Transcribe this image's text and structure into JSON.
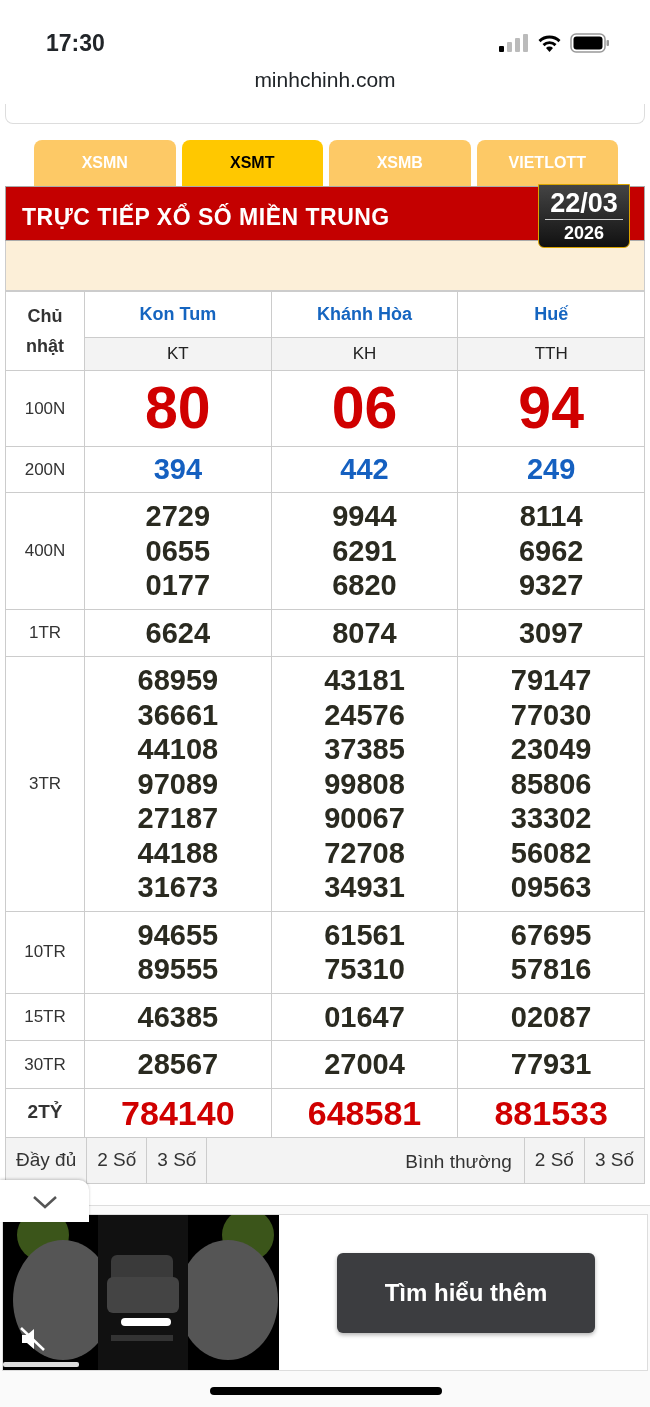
{
  "status_bar": {
    "time": "17:30"
  },
  "browser": {
    "url": "minhchinh.com"
  },
  "tabs": [
    {
      "label": "XSMN",
      "selected": false
    },
    {
      "label": "XSMT",
      "selected": true
    },
    {
      "label": "XSMB",
      "selected": false
    },
    {
      "label": "VIETLOTT",
      "selected": false
    }
  ],
  "header": {
    "title": "TRỰC TIẾP XỔ SỐ MIỀN TRUNG",
    "date": "22/03",
    "year": "2026"
  },
  "table": {
    "weekday": "Chủ nhật",
    "provinces": [
      {
        "name": "Kon Tum",
        "code": "KT"
      },
      {
        "name": "Khánh Hòa",
        "code": "KH"
      },
      {
        "name": "Huế",
        "code": "TTH"
      }
    ],
    "prizes": [
      {
        "label": "100N",
        "kind": "special",
        "values": [
          [
            "80"
          ],
          [
            "06"
          ],
          [
            "94"
          ]
        ]
      },
      {
        "label": "200N",
        "kind": "blue",
        "values": [
          [
            "394"
          ],
          [
            "442"
          ],
          [
            "249"
          ]
        ]
      },
      {
        "label": "400N",
        "kind": "normal",
        "values": [
          [
            "2729",
            "0655",
            "0177"
          ],
          [
            "9944",
            "6291",
            "6820"
          ],
          [
            "8114",
            "6962",
            "9327"
          ]
        ]
      },
      {
        "label": "1TR",
        "kind": "normal",
        "values": [
          [
            "6624"
          ],
          [
            "8074"
          ],
          [
            "3097"
          ]
        ]
      },
      {
        "label": "3TR",
        "kind": "normal",
        "values": [
          [
            "68959",
            "36661",
            "44108",
            "97089",
            "27187",
            "44188",
            "31673"
          ],
          [
            "43181",
            "24576",
            "37385",
            "99808",
            "90067",
            "72708",
            "34931"
          ],
          [
            "79147",
            "77030",
            "23049",
            "85806",
            "33302",
            "56082",
            "09563"
          ]
        ]
      },
      {
        "label": "10TR",
        "kind": "normal",
        "values": [
          [
            "94655",
            "89555"
          ],
          [
            "61561",
            "75310"
          ],
          [
            "67695",
            "57816"
          ]
        ]
      },
      {
        "label": "15TR",
        "kind": "normal",
        "values": [
          [
            "46385"
          ],
          [
            "01647"
          ],
          [
            "02087"
          ]
        ]
      },
      {
        "label": "30TR",
        "kind": "normal",
        "values": [
          [
            "28567"
          ],
          [
            "27004"
          ],
          [
            "77931"
          ]
        ]
      },
      {
        "label": "2TỶ",
        "kind": "jackpot",
        "values": [
          [
            "784140"
          ],
          [
            "648581"
          ],
          [
            "881533"
          ]
        ]
      }
    ]
  },
  "footer": {
    "left": [
      "Đầy đủ",
      "2 Số",
      "3 Số"
    ],
    "mode": "Bình thường",
    "right": [
      "2 Số",
      "3 Số"
    ]
  },
  "ad": {
    "button": "Tìm hiểu thêm"
  }
}
